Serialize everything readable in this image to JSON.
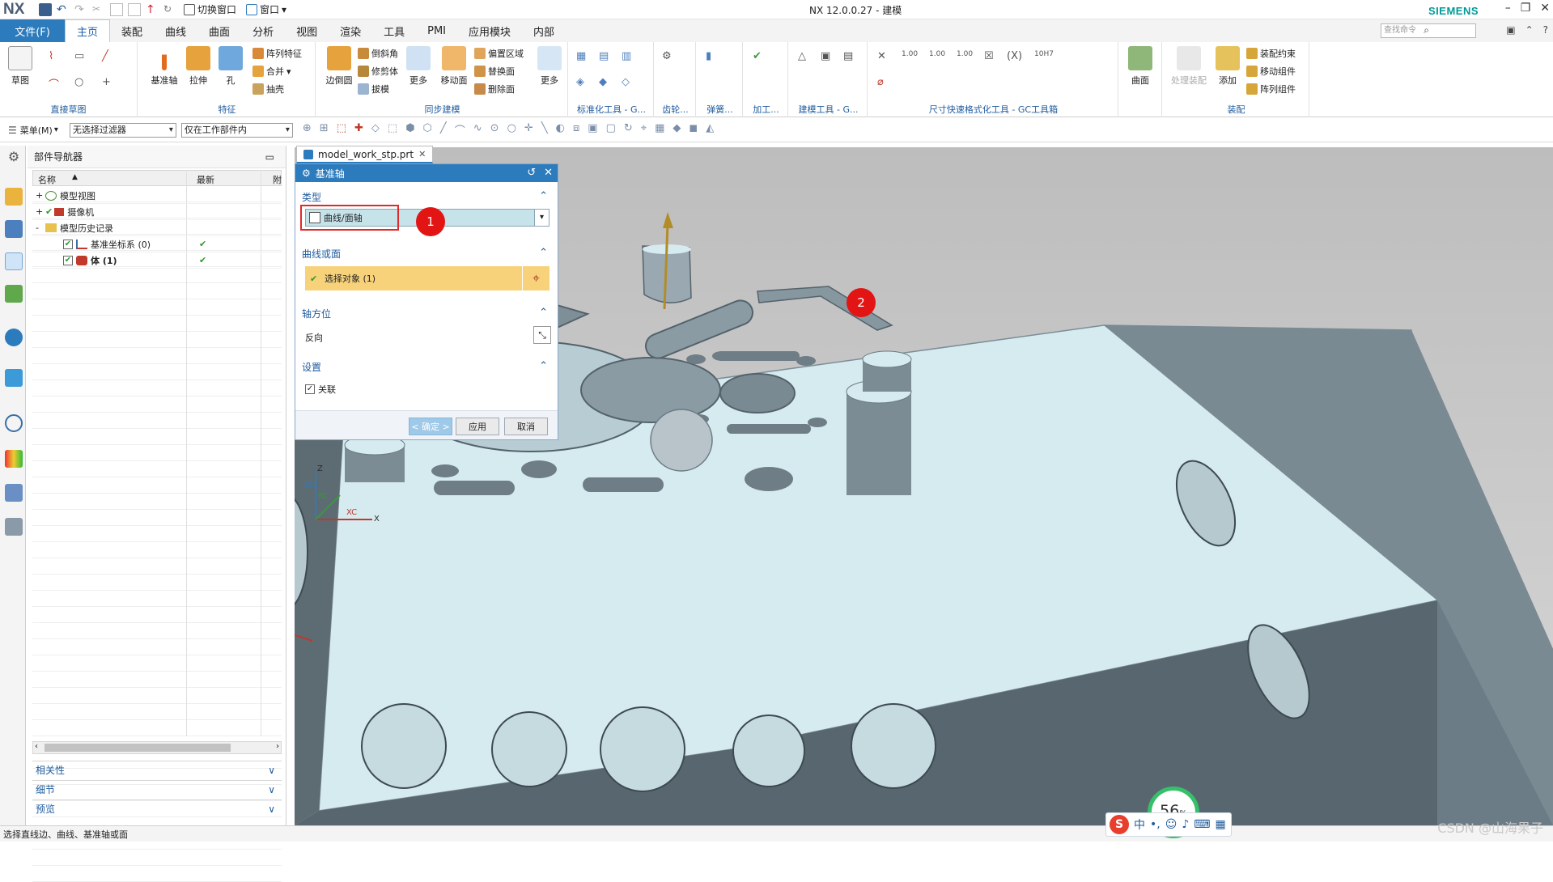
{
  "window": {
    "app_logo": "NX",
    "title": "NX 12.0.0.27 - 建模",
    "brand": "SIEMENS",
    "switch_window_label": "切换窗口",
    "window_menu_label": "窗口"
  },
  "menubar": {
    "file": "文件(F)",
    "tabs": [
      "主页",
      "装配",
      "曲线",
      "曲面",
      "分析",
      "视图",
      "渲染",
      "工具",
      "PMI",
      "应用模块",
      "内部"
    ],
    "active_tab": "主页",
    "search_placeholder": "查找命令"
  },
  "ribbon": {
    "groups": [
      {
        "label": "直接草图",
        "buttons": [
          "草图"
        ]
      },
      {
        "label": "特征",
        "buttons": [
          "基准轴",
          "拉伸",
          "孔"
        ],
        "small": [
          "阵列特征",
          "合并",
          "抽壳"
        ]
      },
      {
        "label": "同步建模",
        "buttons": [
          "边倒圆",
          "更多",
          "移动面"
        ],
        "small": [
          "倒斜角",
          "修剪体",
          "拔模",
          "偏置区域",
          "替换面",
          "删除面"
        ]
      },
      {
        "label": "标准化工具 - G...",
        "buttons": [
          "更多"
        ]
      },
      {
        "label": "齿轮...",
        "buttons": []
      },
      {
        "label": "弹簧...",
        "buttons": []
      },
      {
        "label": "加工...",
        "buttons": []
      },
      {
        "label": "建模工具 - G...",
        "buttons": []
      },
      {
        "label": "尺寸快速格式化工具 - GC工具箱",
        "buttons": []
      },
      {
        "label": "",
        "buttons": [
          "曲面"
        ]
      },
      {
        "label": "装配",
        "buttons": [
          "处理装配",
          "添加"
        ],
        "small": [
          "装配约束",
          "移动组件",
          "阵列组件"
        ]
      }
    ],
    "more_label": "更多"
  },
  "filterbar": {
    "menu_label": "菜单(M)",
    "filter_value": "无选择过滤器",
    "scope_value": "仅在工作部件内"
  },
  "part_navigator": {
    "title": "部件导航器",
    "columns": [
      "名称",
      "最新",
      "附"
    ],
    "rows": [
      {
        "indent": 0,
        "expander": "+",
        "label": "模型视图",
        "check": false,
        "latest": false
      },
      {
        "indent": 0,
        "expander": "+",
        "label": "摄像机",
        "check": true,
        "latest": false
      },
      {
        "indent": 0,
        "expander": "-",
        "label": "模型历史记录",
        "check": false,
        "latest": false
      },
      {
        "indent": 1,
        "expander": "",
        "label": "基准坐标系 (0)",
        "check": true,
        "latest": true
      },
      {
        "indent": 1,
        "expander": "",
        "label": "体 (1)",
        "check": true,
        "latest": true,
        "bold": true
      }
    ],
    "sections": [
      "相关性",
      "细节",
      "预览"
    ]
  },
  "document_tab": {
    "label": "model_work_stp.prt"
  },
  "dialog": {
    "title": "基准轴",
    "type_section": "类型",
    "type_value": "曲线/面轴",
    "curve_section": "曲线或面",
    "select_label": "选择对象 (1)",
    "axis_section": "轴方位",
    "reverse_label": "反向",
    "settings_section": "设置",
    "associative_label": "关联",
    "ok_label": "< 确定 >",
    "apply_label": "应用",
    "cancel_label": "取消"
  },
  "annotations": {
    "marker1": "1",
    "marker2": "2"
  },
  "viewport": {
    "triad_labels": {
      "z": "Z",
      "zc": "ZC",
      "yc": "YC",
      "xc": "XC",
      "x": "X"
    },
    "performance_value": "56",
    "performance_unit": "%"
  },
  "status": {
    "message": "选择直线边、曲线、基准轴或面"
  },
  "ime": {
    "label": "中"
  },
  "watermark": "CSDN @山海果子",
  "colors": {
    "accent": "#2c7bbd",
    "selection": "#f7d27a",
    "marker": "#e31414",
    "model_face": "#d6ebef",
    "model_side": "#5f6e78"
  }
}
